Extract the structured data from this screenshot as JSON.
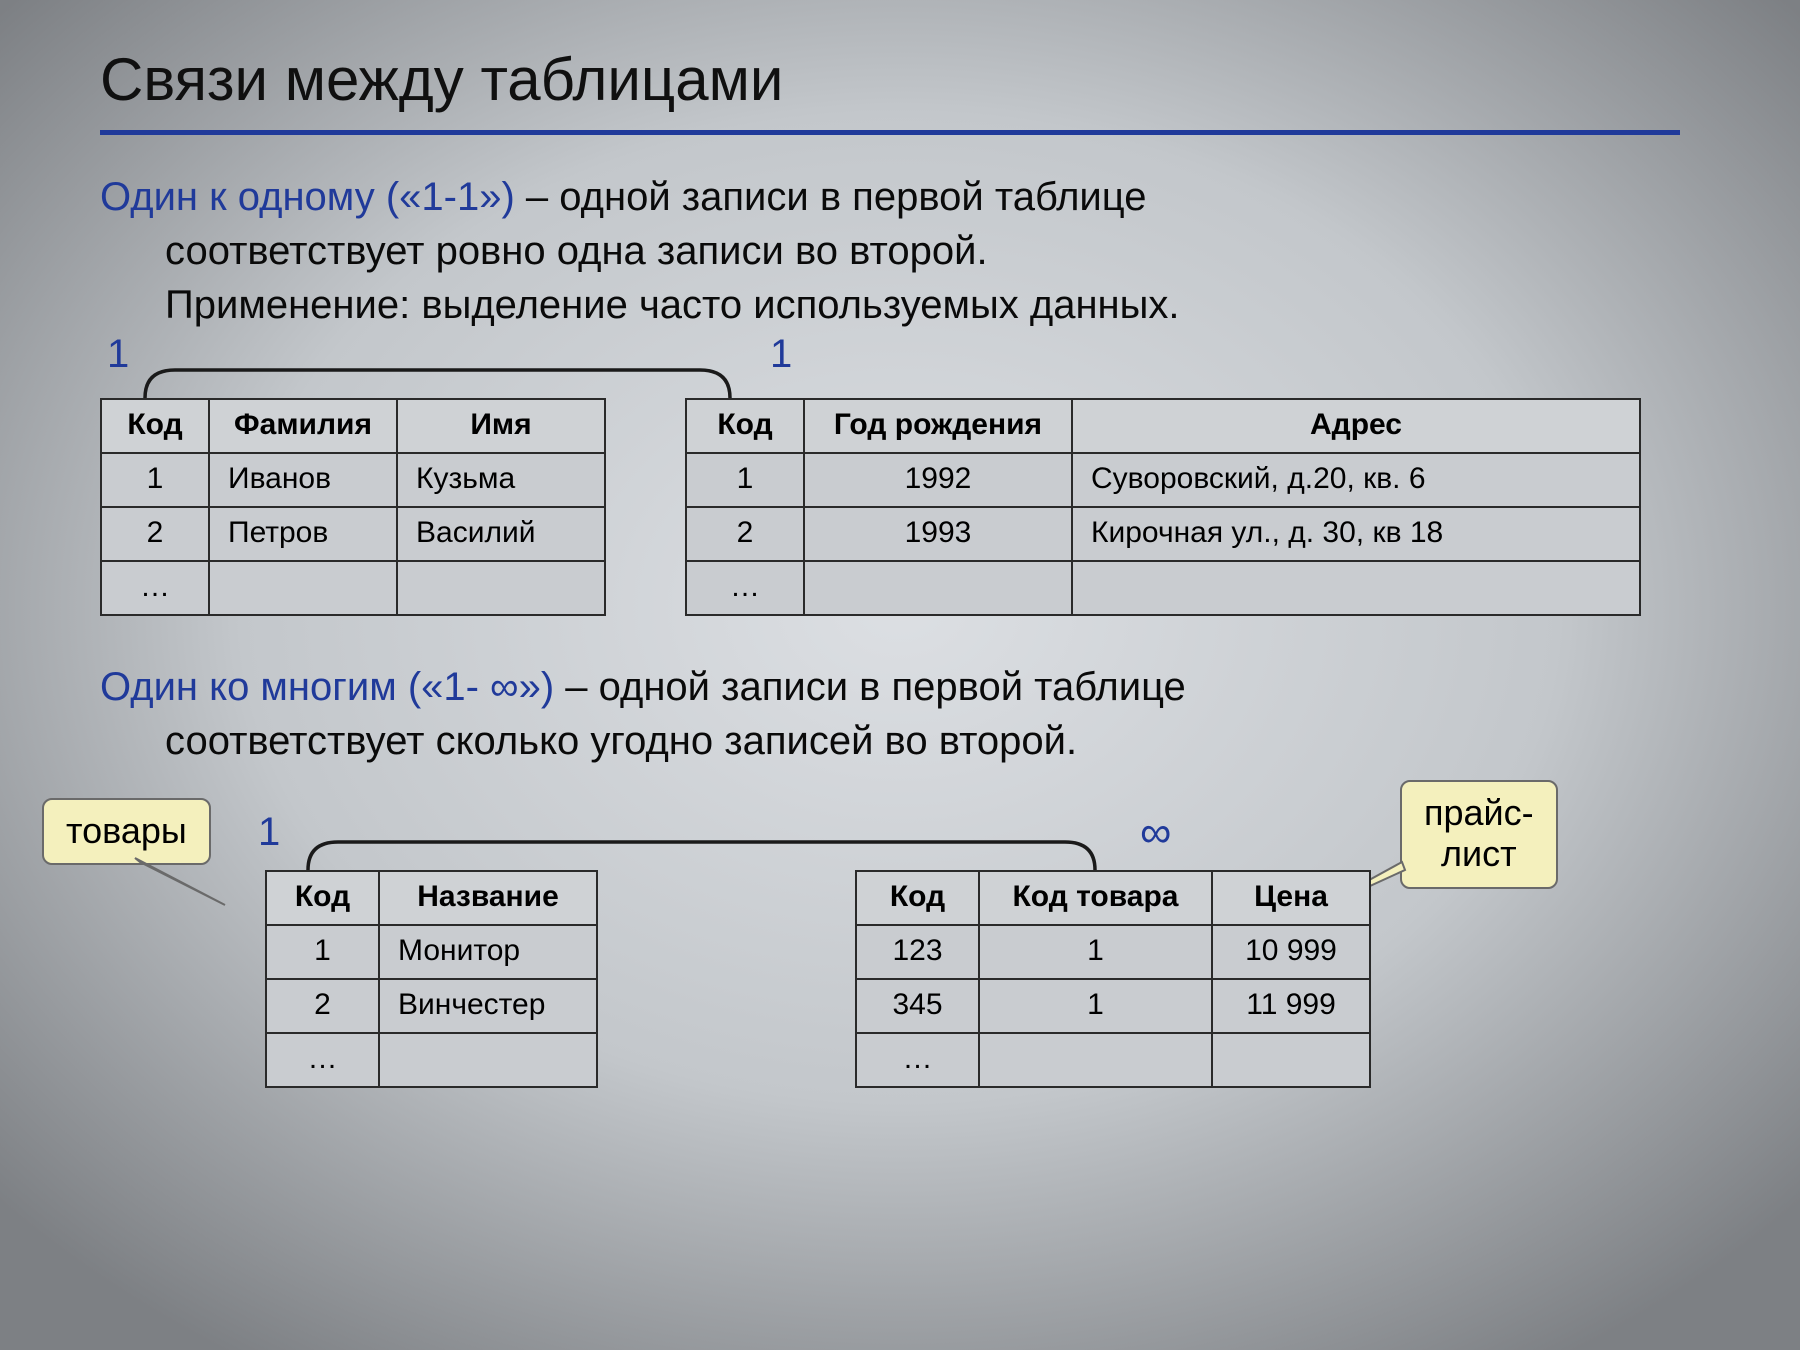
{
  "title": "Связи между таблицами",
  "section1": {
    "accent": "Один к одному («1-1»)",
    "rest1": " – одной записи в первой таблице",
    "line2": "соответствует ровно одна записи во второй.",
    "line3": "Применение: выделение часто используемых данных.",
    "card_left": "1",
    "card_right": "1",
    "tableA": {
      "headers": [
        "Код",
        "Фамилия",
        "Имя"
      ],
      "rows": [
        [
          "1",
          "Иванов",
          "Кузьма"
        ],
        [
          "2",
          "Петров",
          "Василий"
        ],
        [
          "…",
          "",
          ""
        ]
      ]
    },
    "tableB": {
      "headers": [
        "Код",
        "Год рождения",
        "Адрес"
      ],
      "rows": [
        [
          "1",
          "1992",
          "Суворовский, д.20, кв. 6"
        ],
        [
          "2",
          "1993",
          "Кирочная ул., д. 30, кв 18"
        ],
        [
          "…",
          "",
          ""
        ]
      ]
    }
  },
  "section2": {
    "accent": "Один ко многим («1- ∞»)",
    "rest1": " – одной записи в первой таблице",
    "line2": "соответствует сколько угодно записей во второй.",
    "card_left": "1",
    "card_right": "∞",
    "callout_left": "товары",
    "callout_right": "прайс-\nлист",
    "tableA": {
      "headers": [
        "Код",
        "Название"
      ],
      "rows": [
        [
          "1",
          "Монитор"
        ],
        [
          "2",
          "Винчестер"
        ],
        [
          "…",
          ""
        ]
      ]
    },
    "tableB": {
      "headers": [
        "Код",
        "Код товара",
        "Цена"
      ],
      "rows": [
        [
          "123",
          "1",
          "10 999"
        ],
        [
          "345",
          "1",
          "11 999"
        ],
        [
          "…",
          "",
          ""
        ]
      ]
    }
  }
}
